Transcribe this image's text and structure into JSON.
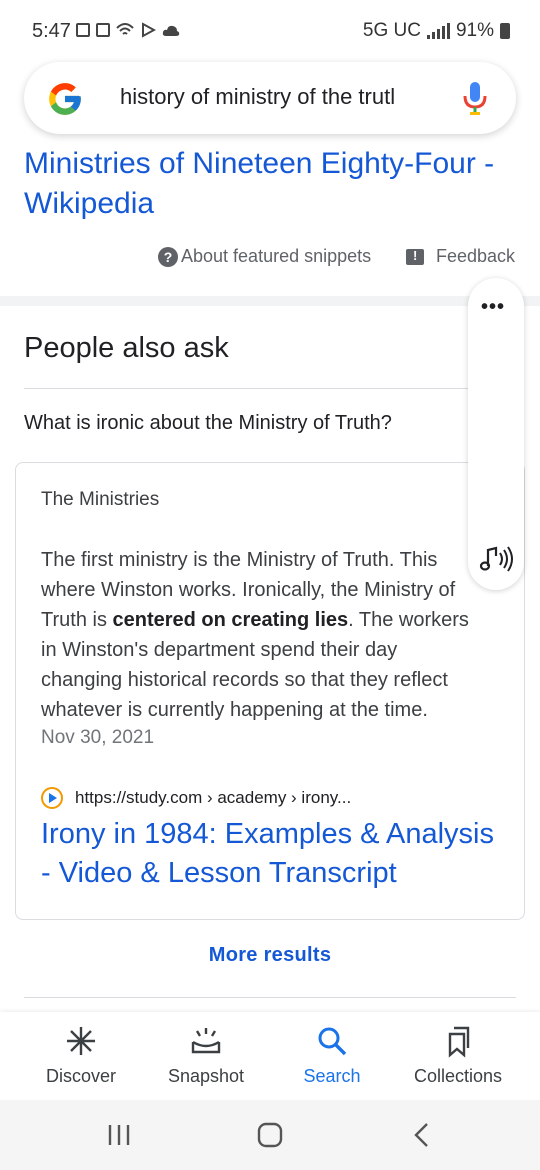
{
  "status_bar": {
    "time": "5:47",
    "network": "5G UC",
    "battery": "91%"
  },
  "search": {
    "query": "history of ministry of the trutl"
  },
  "top_result": {
    "title": "Ministries of Nineteen Eighty-Four - Wikipedia",
    "about_snippets": "About featured snippets",
    "feedback": "Feedback"
  },
  "paa": {
    "heading": "People also ask",
    "question": "What is ironic about the Ministry of Truth?",
    "answer": {
      "heading": "The Ministries",
      "body_part1": " The first ministry is the Ministry of Truth. This where Winston works. Ironically, the Ministry of Truth is ",
      "body_bold": "centered on creating lies",
      "body_part2": ". The workers in Winston's department spend their day changing historical records so that they reflect whatever is currently happening at the time.",
      "date": "Nov 30, 2021",
      "source_url": "https://study.com › academy › irony...",
      "result_title": "Irony in 1984: Examples & Analysis - Video & Lesson Transcript"
    },
    "more_results": "More results"
  },
  "bottom_nav": {
    "items": [
      {
        "label": "Discover",
        "icon": "asterisk-icon"
      },
      {
        "label": "Snapshot",
        "icon": "snapshot-icon"
      },
      {
        "label": "Search",
        "icon": "search-icon"
      },
      {
        "label": "Collections",
        "icon": "bookmark-icon"
      }
    ],
    "active": "Search"
  },
  "colors": {
    "link": "#1558d6",
    "active_nav": "#1a73e8",
    "text": "#202124"
  }
}
